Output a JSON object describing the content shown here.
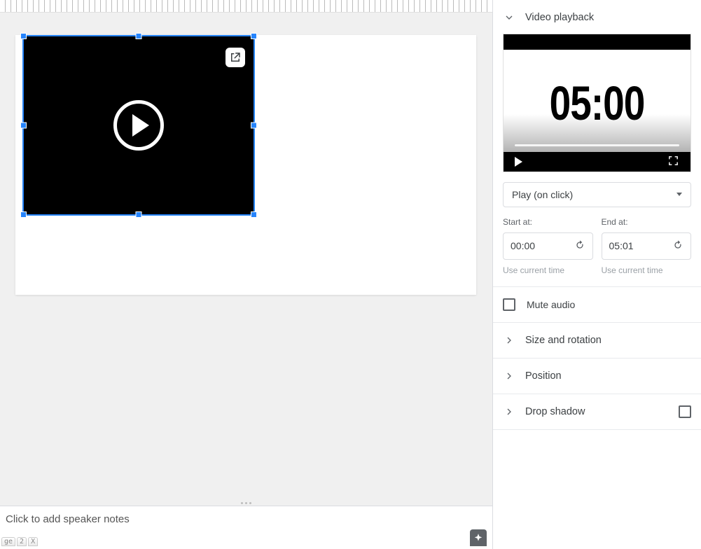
{
  "sidebar": {
    "playback": {
      "title": "Video playback",
      "preview_time": "05:00",
      "play_mode": "Play (on click)",
      "start_label": "Start at:",
      "start_value": "00:00",
      "end_label": "End at:",
      "end_value": "05:01",
      "use_current_hint": "Use current time",
      "mute_label": "Mute audio"
    },
    "size_rotation": {
      "title": "Size and rotation"
    },
    "position": {
      "title": "Position"
    },
    "drop_shadow": {
      "title": "Drop shadow"
    }
  },
  "notes": {
    "placeholder": "Click to add speaker notes",
    "footer_hint": "ge",
    "footer_2": "2",
    "footer_x": "X"
  }
}
